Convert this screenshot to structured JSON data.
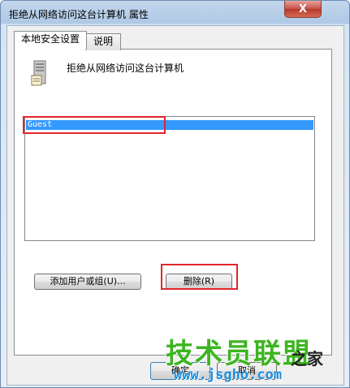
{
  "window": {
    "title": "拒绝从网络访问这台计算机 属性",
    "close_label": "X"
  },
  "tabs": [
    {
      "label": "本地安全设置",
      "active": true
    },
    {
      "label": "说明",
      "active": false
    }
  ],
  "policy": {
    "title": "拒绝从网络访问这台计算机",
    "icon": "server-policy-icon"
  },
  "list": {
    "items": [
      "Guest"
    ],
    "selected_index": 0
  },
  "buttons": {
    "add": "添加用户或组(U)...",
    "remove": "删除(R)",
    "ok": "确定",
    "cancel": "取消"
  },
  "watermark": {
    "brand": "技术员联盟",
    "home": "之家",
    "url": "www.jsgho.com"
  },
  "colors": {
    "selection": "#3399ff",
    "highlight_box": "#e3262a",
    "watermark_green": "#3cb521",
    "watermark_blue": "#1a8fe0"
  }
}
